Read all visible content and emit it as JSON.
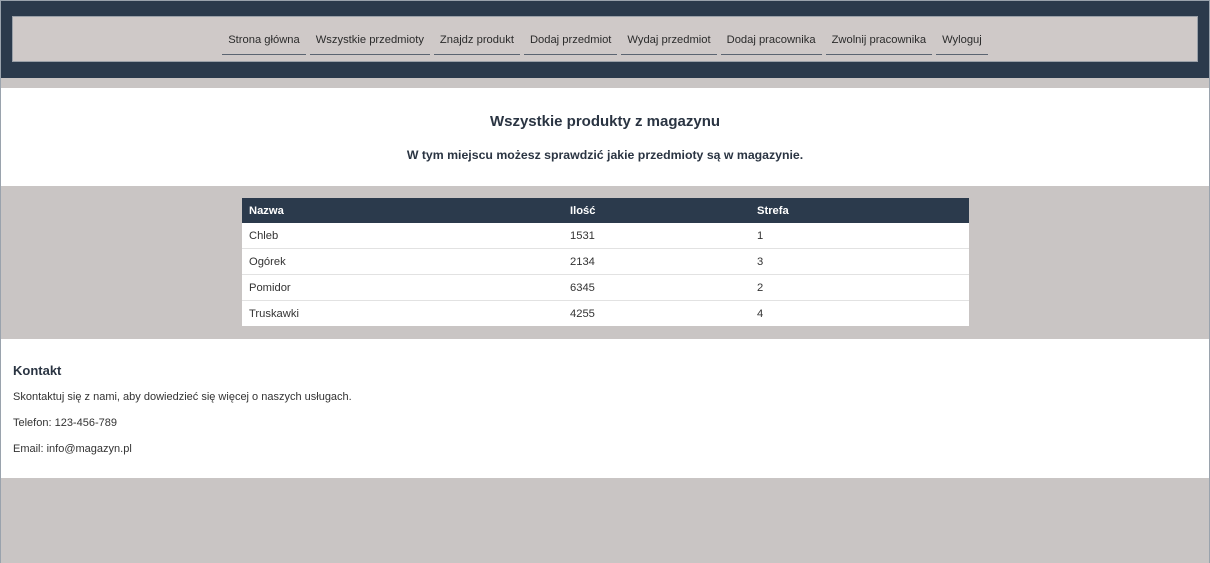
{
  "nav": {
    "items": [
      {
        "label": "Strona główna"
      },
      {
        "label": "Wszystkie przedmioty"
      },
      {
        "label": "Znajdz produkt"
      },
      {
        "label": "Dodaj przedmiot"
      },
      {
        "label": "Wydaj przedmiot"
      },
      {
        "label": "Dodaj pracownika"
      },
      {
        "label": "Zwolnij pracownika"
      },
      {
        "label": "Wyloguj"
      }
    ]
  },
  "hero": {
    "title": "Wszystkie produkty z magazynu",
    "subtitle": "W tym miejscu możesz sprawdzić jakie przedmioty są w magazynie."
  },
  "table": {
    "headers": [
      "Nazwa",
      "Ilość",
      "Strefa"
    ],
    "rows": [
      [
        "Chleb",
        "1531",
        "1"
      ],
      [
        "Ogórek",
        "2134",
        "3"
      ],
      [
        "Pomidor",
        "6345",
        "2"
      ],
      [
        "Truskawki",
        "4255",
        "4"
      ]
    ]
  },
  "footer": {
    "title": "Kontakt",
    "text": "Skontaktuj się z nami, aby dowiedzieć się więcej o naszych usługach.",
    "phone": "Telefon: 123-456-789",
    "email": "Email: info@magazyn.pl"
  },
  "colors": {
    "header_bg": "#2b3a4c",
    "page_bg": "#c9c5c4",
    "nav_bg": "#cfc9c8",
    "content_bg": "#ffffff"
  }
}
